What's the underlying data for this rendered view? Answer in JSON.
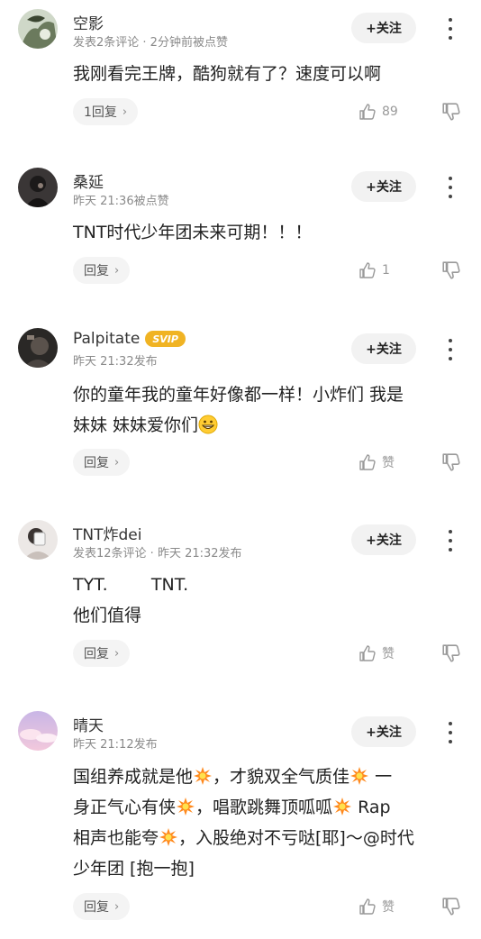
{
  "comments": [
    {
      "username": "空影",
      "meta": "发表2条评论 · 2分钟前被点赞",
      "follow_label": "+关注",
      "lines": [
        "我刚看完王牌，酷狗就有了？速度可以啊"
      ],
      "reply_label": "1回复",
      "like_label": "89"
    },
    {
      "username": "桑延",
      "meta": "昨天 21:36被点赞",
      "follow_label": "+关注",
      "lines": [
        "TNT时代少年团未来可期！！！"
      ],
      "reply_label": "回复",
      "like_label": "1"
    },
    {
      "username": "Palpitate",
      "badge": "SVIP",
      "meta": "昨天 21:32发布",
      "follow_label": "+关注",
      "lines": [
        "你的童年我的童年好像都一样！小炸们 我是",
        "妹妹 妹妹爱你们"
      ],
      "reply_label": "回复",
      "like_label": "赞"
    },
    {
      "username": "TNT炸dei",
      "meta": "发表12条评论 · 昨天 21:32发布",
      "follow_label": "+关注",
      "lines": [
        "TYT.        TNT.",
        "他们值得"
      ],
      "reply_label": "回复",
      "like_label": "赞"
    },
    {
      "username": "晴天",
      "meta": "昨天 21:12发布",
      "follow_label": "+关注",
      "lines": [
        "国组养成就是他",
        "，才貌双全气质佳",
        " 一",
        "身正气心有侠",
        "，唱歌跳舞顶呱呱",
        " Rap",
        "相声也能夸",
        "，入股绝对不亏哒[耶]～@时代",
        "少年团 [抱一抱]"
      ],
      "reply_label": "回复",
      "like_label": "赞"
    }
  ],
  "icons": {
    "more": "more-vertical-icon",
    "like": "thumbs-up-icon",
    "dislike": "thumbs-down-icon",
    "chevron": "chevron-right-icon",
    "grin_emoji": "grinning-face-emoji",
    "boom_emoji": "collision-emoji"
  },
  "colors": {
    "svip_badge": "#f0b323",
    "follow_bg": "#f2f2f2",
    "reply_bg": "#f4f4f4"
  }
}
